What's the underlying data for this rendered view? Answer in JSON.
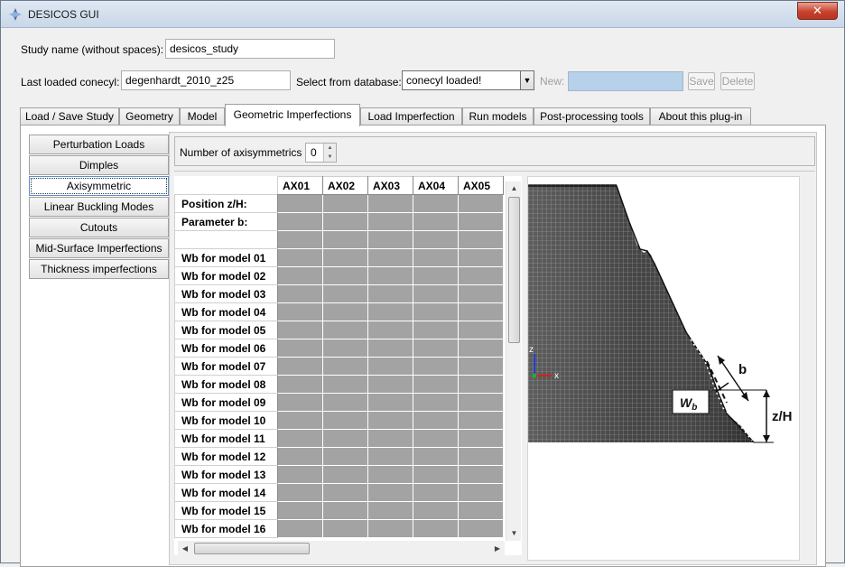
{
  "window": {
    "title": "DESICOS GUI",
    "close_label": "✕"
  },
  "header": {
    "study_label": "Study name (without spaces):",
    "study_value": "desicos_study",
    "last_conecyl_label": "Last loaded conecyl:",
    "last_conecyl_value": "degenhardt_2010_z25",
    "select_db_label": "Select from database:",
    "select_db_value": "conecyl loaded!",
    "new_label": "New:",
    "save_label": "Save",
    "delete_label": "Delete"
  },
  "tabs": [
    {
      "label": "Load / Save Study"
    },
    {
      "label": "Geometry"
    },
    {
      "label": "Model"
    },
    {
      "label": "Geometric Imperfections"
    },
    {
      "label": "Load Imperfection"
    },
    {
      "label": "Run models"
    },
    {
      "label": "Post-processing tools"
    },
    {
      "label": "About this plug-in"
    }
  ],
  "side_tabs": [
    {
      "label": "Perturbation Loads"
    },
    {
      "label": "Dimples"
    },
    {
      "label": "Axisymmetric"
    },
    {
      "label": "Linear Buckling Modes"
    },
    {
      "label": "Cutouts"
    },
    {
      "label": "Mid-Surface Imperfections"
    },
    {
      "label": "Thickness imperfections"
    }
  ],
  "axisym": {
    "count_label": "Number of axisymmetrics",
    "count_value": "0"
  },
  "table": {
    "columns": [
      "AX01",
      "AX02",
      "AX03",
      "AX04",
      "AX05"
    ],
    "rows": [
      "Position z/H:",
      "Parameter b:",
      "",
      "Wb for model 01",
      "Wb for model 02",
      "Wb for model 03",
      "Wb for model 04",
      "Wb for model 05",
      "Wb for model 06",
      "Wb for model 07",
      "Wb for model 08",
      "Wb for model 09",
      "Wb for model 10",
      "Wb for model 11",
      "Wb for model 12",
      "Wb for model 13",
      "Wb for model 14",
      "Wb for model 15",
      "Wb for model 16"
    ]
  },
  "figure": {
    "axis_z": "z",
    "axis_x": "x",
    "label_b": "b",
    "label_wb": "W",
    "label_wb_sub": "b",
    "label_zh": "z/H"
  }
}
